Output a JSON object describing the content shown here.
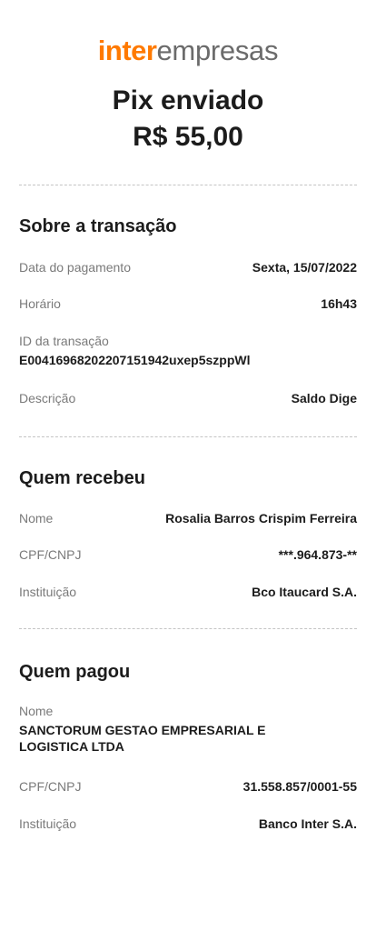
{
  "logo": {
    "brand": "inter",
    "sub": "empresas",
    "brand_color": "#ff7a00"
  },
  "header": {
    "title": "Pix enviado",
    "amount": "R$ 55,00"
  },
  "transaction": {
    "title": "Sobre a transação",
    "payment_date_label": "Data do pagamento",
    "payment_date": "Sexta, 15/07/2022",
    "time_label": "Horário",
    "time": "16h43",
    "id_label": "ID da transação",
    "id": "E00416968202207151942uxep5szppWl",
    "description_label": "Descrição",
    "description": "Saldo Dige"
  },
  "receiver": {
    "title": "Quem recebeu",
    "name_label": "Nome",
    "name": "Rosalia Barros Crispim Ferreira",
    "doc_label": "CPF/CNPJ",
    "doc": "***.964.873-**",
    "institution_label": "Instituição",
    "institution": "Bco Itaucard S.A."
  },
  "payer": {
    "title": "Quem pagou",
    "name_label": "Nome",
    "name": "SANCTORUM GESTAO EMPRESARIAL E LOGISTICA LTDA",
    "doc_label": "CPF/CNPJ",
    "doc": "31.558.857/0001-55",
    "institution_label": "Instituição",
    "institution": "Banco Inter S.A."
  }
}
